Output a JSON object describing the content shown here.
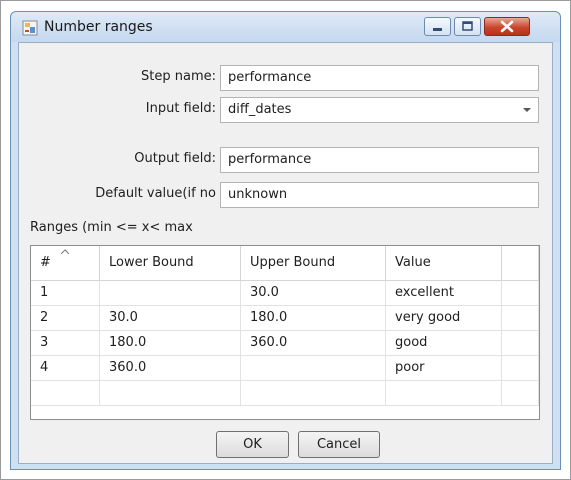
{
  "window": {
    "title": "Number ranges"
  },
  "form": {
    "step_name_label": "Step name:",
    "step_name_value": "performance",
    "input_field_label": "Input field:",
    "input_field_value": "diff_dates",
    "output_field_label": "Output field:",
    "output_field_value": "performance",
    "default_value_label": "Default value(if no",
    "default_value_value": "unknown",
    "ranges_label": "Ranges (min <= x< max"
  },
  "table": {
    "headers": [
      "#",
      "Lower Bound",
      "Upper Bound",
      "Value",
      ""
    ],
    "rows": [
      [
        "1",
        "",
        "30.0",
        "excellent"
      ],
      [
        "2",
        "30.0",
        "180.0",
        "very good"
      ],
      [
        "3",
        "180.0",
        "360.0",
        "good"
      ],
      [
        "4",
        "360.0",
        "",
        "poor"
      ],
      [
        "",
        "",
        "",
        ""
      ]
    ]
  },
  "buttons": {
    "ok": "OK",
    "cancel": "Cancel"
  }
}
